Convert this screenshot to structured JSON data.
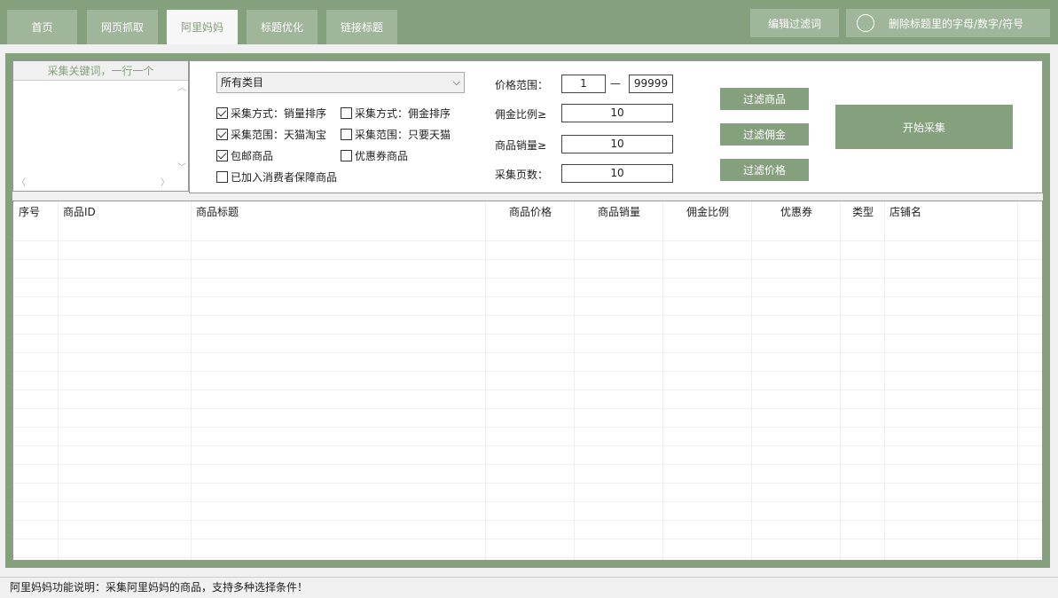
{
  "tabs": [
    {
      "label": "首页",
      "active": false
    },
    {
      "label": "网页抓取",
      "active": false
    },
    {
      "label": "阿里妈妈",
      "active": true
    },
    {
      "label": "标题优化",
      "active": false
    },
    {
      "label": "链接标题",
      "active": false
    }
  ],
  "top_buttons": {
    "edit_filter": "编辑过滤词",
    "remove_chars": "删除标题里的字母/数字/符号"
  },
  "keywords": {
    "title": "采集关键词，一行一个",
    "value": ""
  },
  "category_select": {
    "selected": "所有类目"
  },
  "checkboxes": [
    {
      "label": "采集方式：销量排序",
      "checked": true
    },
    {
      "label": "采集方式：佣金排序",
      "checked": false
    },
    {
      "label": "采集范围：天猫淘宝",
      "checked": true
    },
    {
      "label": "采集范围：只要天猫",
      "checked": false
    },
    {
      "label": "包邮商品",
      "checked": true
    },
    {
      "label": "优惠券商品",
      "checked": false
    },
    {
      "label": "已加入消费者保障商品",
      "checked": false
    }
  ],
  "fields": {
    "price_label": "价格范围：",
    "price_min": "1",
    "price_dash": "—",
    "price_max": "99999",
    "commission_label": "佣金比例≥",
    "commission_value": "10",
    "sales_label": "商品销量≥",
    "sales_value": "10",
    "pages_label": "采集页数：",
    "pages_value": "10"
  },
  "action_buttons": {
    "filter_goods": "过滤商品",
    "filter_commission": "过滤佣金",
    "filter_price": "过滤价格",
    "start": "开始采集"
  },
  "table": {
    "columns": [
      "序号",
      "商品ID",
      "商品标题",
      "商品价格",
      "商品销量",
      "佣金比例",
      "优惠券",
      "类型",
      "店铺名"
    ],
    "rows": []
  },
  "status_text": "阿里妈妈功能说明：采集阿里妈妈的商品，支持多种选择条件！"
}
